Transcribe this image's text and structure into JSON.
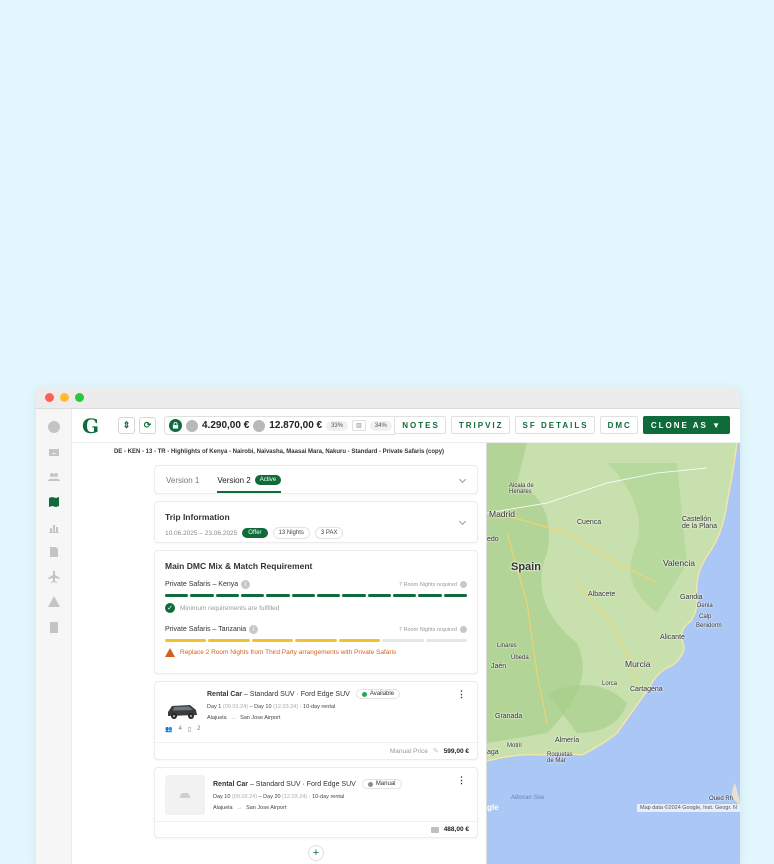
{
  "topbar": {
    "logo": "G",
    "price_left": "4.290,00 €",
    "price_right": "12.870,00 €",
    "pct_margin": "33%",
    "pct_other": "34%",
    "nav": [
      "NOTES",
      "TRIPVIZ",
      "SF DETAILS",
      "DMC"
    ],
    "clone_label": "CLONE AS ▼"
  },
  "breadcrumb": "DE - KEN - 13 - TR - Highlights of Kenya - Nairobi, Naivasha, Maasai Mara, Nakuru - Standard - Private Safaris (copy)",
  "versions": {
    "v1": "Version 1",
    "v2": "Version 2",
    "active_badge": "Active"
  },
  "trip": {
    "title": "Trip Information",
    "dates": "10.06.2025 – 23.06.2025",
    "offer": "Offer",
    "nights": "13 Nights",
    "pax": "3 PAX"
  },
  "dmc": {
    "title": "Main DMC Mix & Match Requirement",
    "kenya": {
      "name": "Private Safaris – Kenya",
      "required": "7 Room Nights required",
      "filled": 12,
      "total": 12,
      "status": "Minimum requirements are fulfilled"
    },
    "tanzania": {
      "name": "Private Safaris – Tanzania",
      "required": "7 Room Nights required",
      "filled": 5,
      "total": 7,
      "status": "Replace 2 Room Nights from Third Party arrangements with Private Safaris"
    }
  },
  "car1": {
    "title_bold": "Rental Car",
    "title_rest": "– Standard SUV · Ford Edge SUV",
    "status": "Available",
    "day_start": "Day 1",
    "date_start": "(09.03.24)",
    "dash": "–",
    "day_end": "Day 10",
    "date_end": "(12.03.24)",
    "rental": "· 10-day rental",
    "from": "Alajuela",
    "arrow": "→",
    "to": "San Jose Airport",
    "people": "4",
    "luggage": "2",
    "price_label": "Manual Price",
    "price": "599,00 €"
  },
  "car2": {
    "title_bold": "Rental Car",
    "title_rest": "– Standard SUV · Ford Edge SUV",
    "status": "Manual",
    "day_start": "Day 10",
    "date_start": "(09.03.24)",
    "dash": "–",
    "day_end": "Day 20",
    "date_end": "(12.03.24)",
    "rental": "· 10-day rental",
    "from": "Alajuela",
    "arrow": "→",
    "to": "San Jose Airport",
    "price": "488,00 €"
  },
  "add_label": "+",
  "map": {
    "labels": {
      "alcala": "Alcala de\nHenares",
      "madrid": "Madrid",
      "cuenca": "Cuenca",
      "castellon": "Castellón\nde la Plana",
      "spain": "Spain",
      "valencia": "Valencia",
      "albacete": "Albacete",
      "gandia": "Gandia",
      "denia": "Denia",
      "calp": "Calp",
      "benidorm": "Benidorm",
      "alicante": "Alicante",
      "linares": "Linares",
      "ubeda": "Úbeda",
      "jaen": "Jaén",
      "murcia": "Murcia",
      "lorca": "Lorca",
      "cartagena": "Cartagena",
      "granada": "Granada",
      "almeria": "Almería",
      "motril": "Motril",
      "roquetas": "Roquetas\nde Mar",
      "aga": "aga",
      "edo": "edo",
      "alboran": "Alboran Sea",
      "oued": "Oued Rh"
    },
    "attribution": "Map data ©2024 Google, Inst. Geogr. N",
    "google": "gle"
  }
}
